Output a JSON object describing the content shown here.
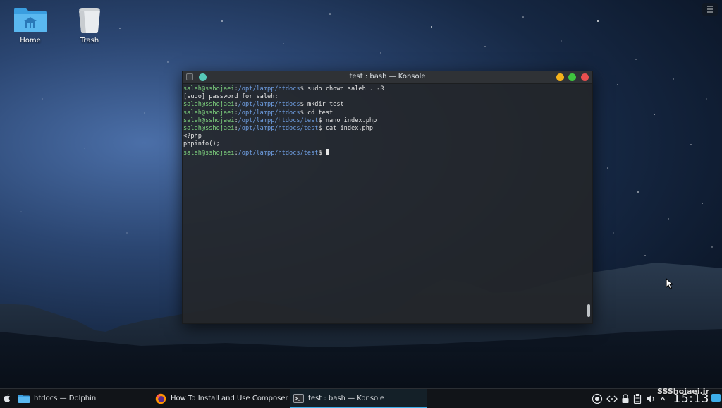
{
  "desktop": {
    "icons": [
      {
        "label": "Home",
        "icon": "folder-home-icon"
      },
      {
        "label": "Trash",
        "icon": "trash-icon"
      }
    ]
  },
  "konsole": {
    "title": "test : bash — Konsole",
    "lines": [
      {
        "user": "saleh@sshojaei",
        "path": "/opt/lampp/htdocs",
        "command": " sudo chown saleh . -R"
      },
      {
        "text": "[sudo] password for saleh:"
      },
      {
        "user": "saleh@sshojaei",
        "path": "/opt/lampp/htdocs",
        "command": " mkdir test"
      },
      {
        "user": "saleh@sshojaei",
        "path": "/opt/lampp/htdocs",
        "command": " cd test"
      },
      {
        "user": "saleh@sshojaei",
        "path": "/opt/lampp/htdocs/test",
        "command": " nano index.php"
      },
      {
        "user": "saleh@sshojaei",
        "path": "/opt/lampp/htdocs/test",
        "command": " cat index.php"
      },
      {
        "text": "<?php"
      },
      {
        "text": "phpinfo();"
      },
      {
        "user": "saleh@sshojaei",
        "path": "/opt/lampp/htdocs/test",
        "command": " "
      }
    ]
  },
  "taskbar": {
    "tasks": [
      {
        "label": "htdocs — Dolphin",
        "icon": "dolphin-folder-icon"
      },
      {
        "label": "How To Install and Use Composer ...",
        "icon": "firefox-icon"
      },
      {
        "label": "test : bash — Konsole",
        "icon": "konsole-icon",
        "active": true
      }
    ],
    "clock": "15:13",
    "watermark": "SSShojaei.ir"
  },
  "colors": {
    "accent": "#3daee9",
    "prompt_user": "#7fd37f",
    "prompt_path": "#6f9fe3",
    "terminal_bg": "#232629",
    "btn_minimize": "#f5b21b",
    "btn_maximize": "#3fc43f",
    "btn_close": "#e94f4f",
    "btn_pin": "#56c8b8"
  }
}
